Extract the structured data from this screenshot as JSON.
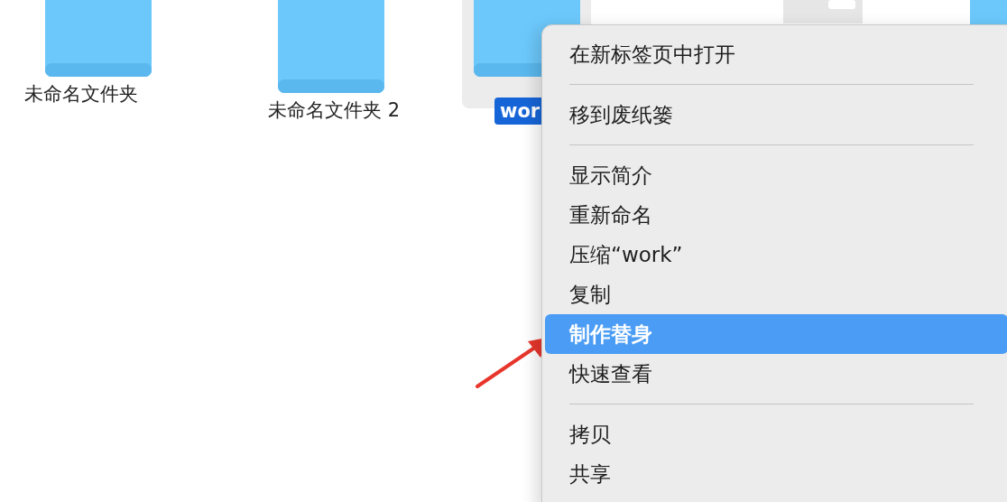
{
  "desktop_items": [
    {
      "kind": "folder",
      "label": "未命名文件夹",
      "selected": false
    },
    {
      "kind": "folder",
      "label": "未命名文件夹 2",
      "selected": false
    },
    {
      "kind": "folder",
      "label": "wor",
      "selected": true
    },
    {
      "kind": "document"
    },
    {
      "kind": "folder"
    }
  ],
  "context_menu": {
    "sections": [
      [
        {
          "label": "在新标签页中打开",
          "selected": false
        }
      ],
      [
        {
          "label": "移到废纸篓",
          "selected": false
        }
      ],
      [
        {
          "label": "显示简介",
          "selected": false
        },
        {
          "label": "重新命名",
          "selected": false
        },
        {
          "label": "压缩“work”",
          "selected": false
        },
        {
          "label": "复制",
          "selected": false
        },
        {
          "label": "制作替身",
          "selected": true
        },
        {
          "label": "快速查看",
          "selected": false
        }
      ],
      [
        {
          "label": "拷贝",
          "selected": false
        },
        {
          "label": "共享",
          "selected": false
        }
      ]
    ]
  },
  "annotation": {
    "kind": "arrow"
  }
}
